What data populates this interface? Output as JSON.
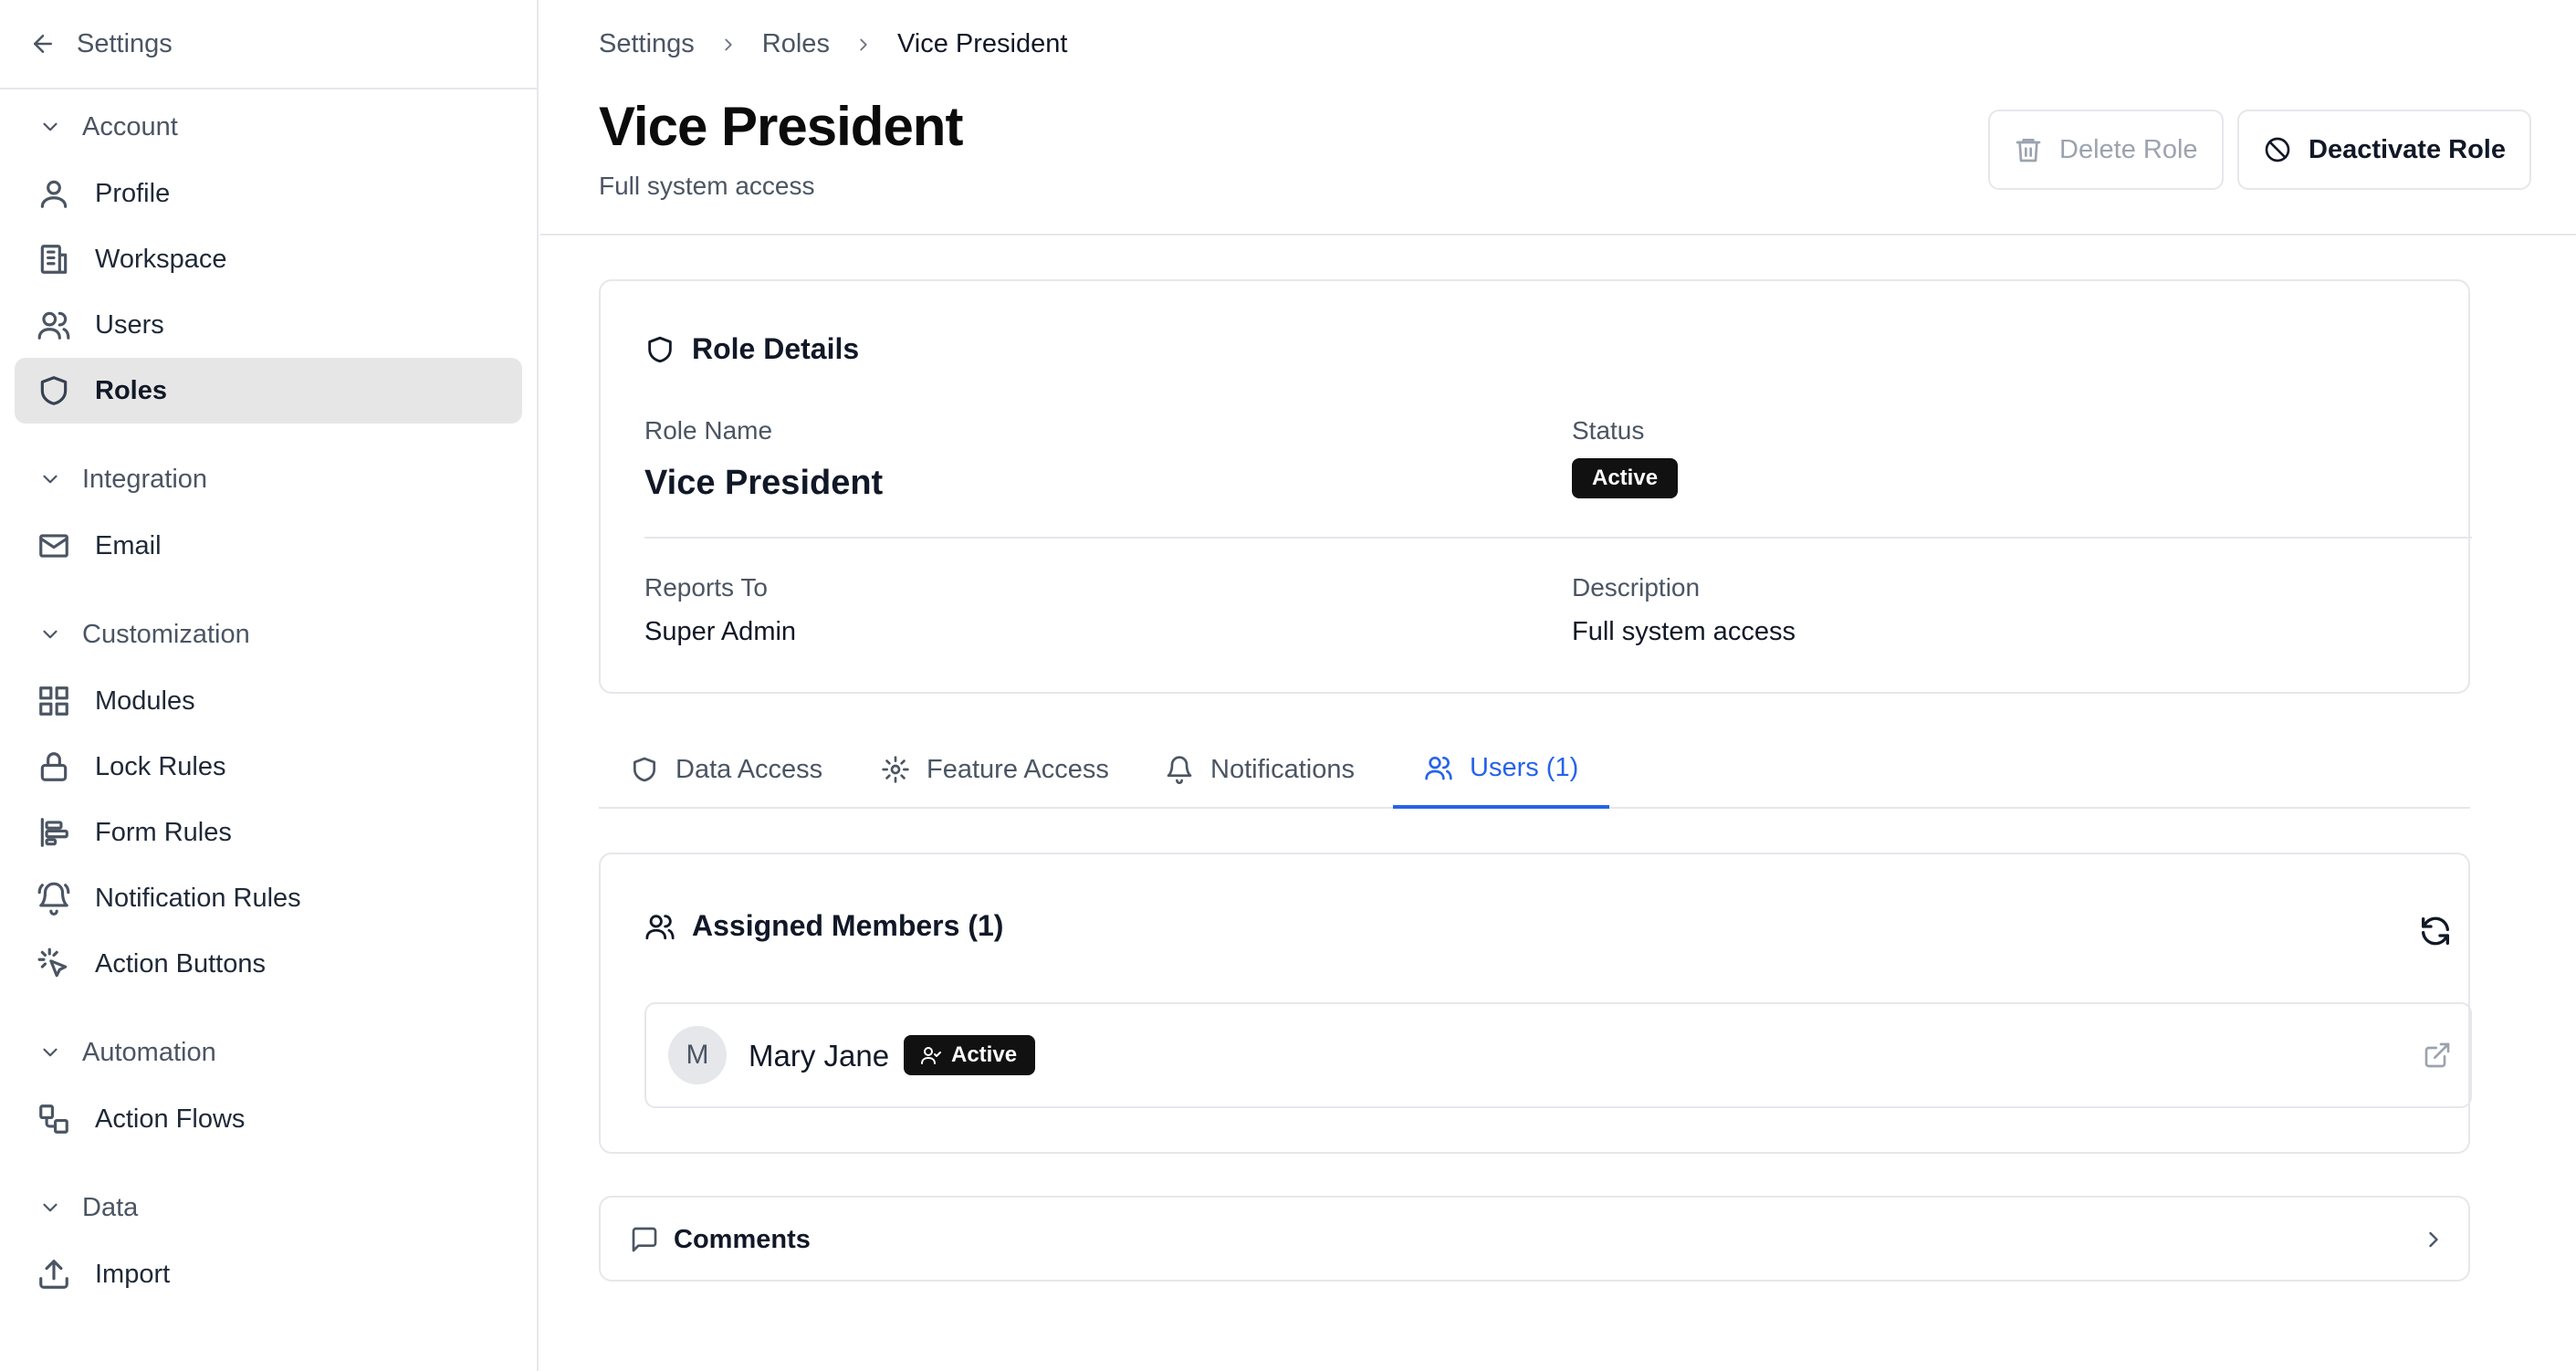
{
  "sidebar": {
    "back_label": "Settings",
    "sections": [
      {
        "label": "Account",
        "items": [
          {
            "label": "Profile",
            "icon": "user-icon"
          },
          {
            "label": "Workspace",
            "icon": "building-icon"
          },
          {
            "label": "Users",
            "icon": "users-icon"
          },
          {
            "label": "Roles",
            "icon": "shield-icon",
            "active": true
          }
        ]
      },
      {
        "label": "Integration",
        "items": [
          {
            "label": "Email",
            "icon": "mail-icon"
          }
        ]
      },
      {
        "label": "Customization",
        "items": [
          {
            "label": "Modules",
            "icon": "grid-icon"
          },
          {
            "label": "Lock Rules",
            "icon": "lock-icon"
          },
          {
            "label": "Form Rules",
            "icon": "align-left-icon"
          },
          {
            "label": "Notification Rules",
            "icon": "bell-ring-icon"
          },
          {
            "label": "Action Buttons",
            "icon": "pointer-click-icon"
          }
        ]
      },
      {
        "label": "Automation",
        "items": [
          {
            "label": "Action Flows",
            "icon": "workflow-icon"
          }
        ]
      },
      {
        "label": "Data",
        "items": [
          {
            "label": "Import",
            "icon": "upload-icon"
          }
        ]
      }
    ]
  },
  "breadcrumb": [
    "Settings",
    "Roles",
    "Vice President"
  ],
  "header": {
    "title": "Vice President",
    "subtitle": "Full system access",
    "delete_label": "Delete Role",
    "deactivate_label": "Deactivate Role"
  },
  "details": {
    "title": "Role Details",
    "role_name_label": "Role Name",
    "role_name": "Vice President",
    "status_label": "Status",
    "status": "Active",
    "reports_to_label": "Reports To",
    "reports_to": "Super Admin",
    "description_label": "Description",
    "description": "Full system access"
  },
  "tabs": [
    {
      "label": "Data Access",
      "icon": "shield-icon"
    },
    {
      "label": "Feature Access",
      "icon": "gear-icon"
    },
    {
      "label": "Notifications",
      "icon": "bell-icon"
    },
    {
      "label": "Users (1)",
      "icon": "users-icon",
      "active": true
    }
  ],
  "members": {
    "title": "Assigned Members (1)",
    "list": [
      {
        "initial": "M",
        "name": "Mary Jane",
        "status": "Active"
      }
    ]
  },
  "comments": {
    "label": "Comments"
  },
  "colors": {
    "accent": "#2563eb",
    "badge_bg": "#111111",
    "active_nav_bg": "#e6e6e6"
  }
}
